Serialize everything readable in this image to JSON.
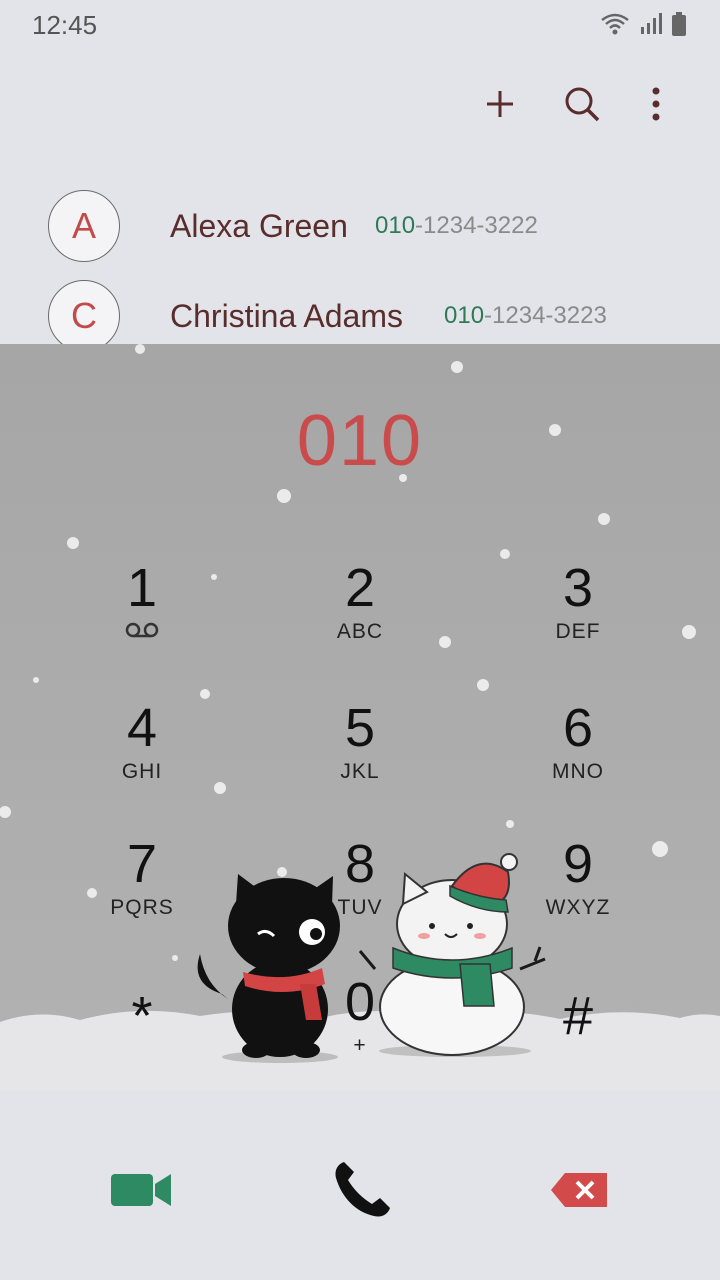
{
  "status": {
    "time": "12:45"
  },
  "toolbar": {
    "add_icon": "plus-icon",
    "search_icon": "search-icon",
    "menu_icon": "more-vert-icon"
  },
  "contacts": [
    {
      "initial": "A",
      "name": "Alexa Green",
      "number_match": "010",
      "number_rest": "-1234-3222"
    },
    {
      "initial": "C",
      "name": "Christina Adams",
      "number_match": "010",
      "number_rest": "-1234-3223"
    }
  ],
  "dialed": "010",
  "keys": [
    {
      "digit": "1",
      "letters": ""
    },
    {
      "digit": "2",
      "letters": "ABC"
    },
    {
      "digit": "3",
      "letters": "DEF"
    },
    {
      "digit": "4",
      "letters": "GHI"
    },
    {
      "digit": "5",
      "letters": "JKL"
    },
    {
      "digit": "6",
      "letters": "MNO"
    },
    {
      "digit": "7",
      "letters": "PQRS"
    },
    {
      "digit": "8",
      "letters": "TUV"
    },
    {
      "digit": "9",
      "letters": "WXYZ"
    },
    {
      "digit": "*",
      "letters": ""
    },
    {
      "digit": "0",
      "letters": "+"
    },
    {
      "digit": "#",
      "letters": ""
    }
  ],
  "bottom": {
    "video_icon": "video-call-icon",
    "call_icon": "phone-icon",
    "delete_icon": "backspace-icon"
  },
  "colors": {
    "accent_red": "#c94b4b",
    "match_green": "#2f7a55",
    "video_green": "#2e8a63",
    "delete_red": "#d24a4a"
  }
}
